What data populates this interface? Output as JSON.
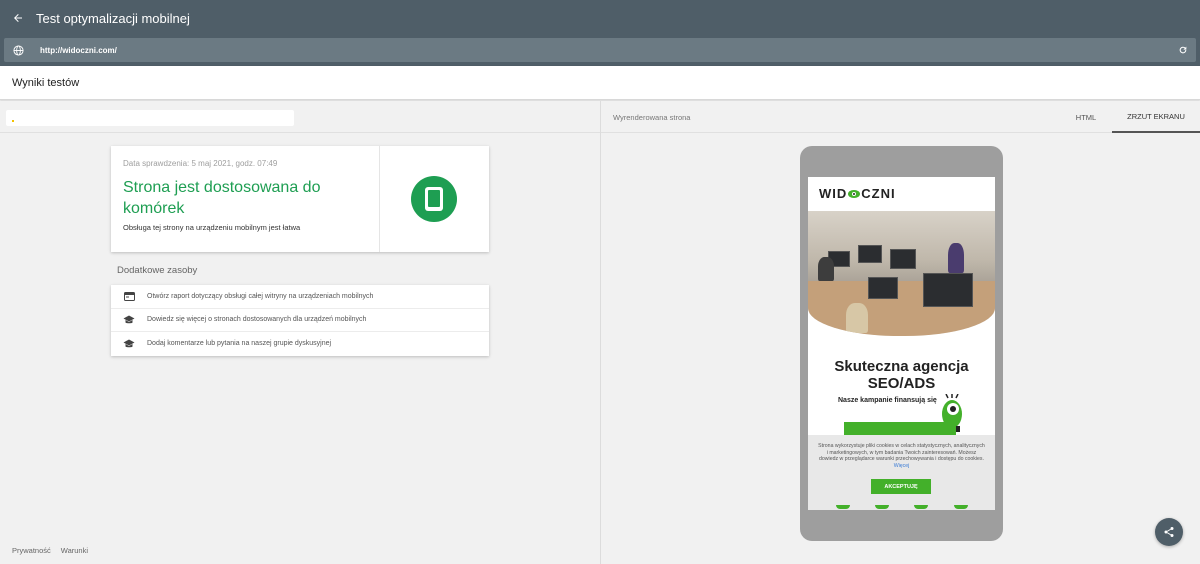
{
  "app": {
    "title": "Test optymalizacji mobilnej",
    "url": "http://widoczni.com/"
  },
  "results_header": "Wyniki testów",
  "result_card": {
    "date": "Data sprawdzenia: 5 maj 2021, godz. 07:49",
    "headline": "Strona jest dostosowana do komórek",
    "description": "Obsługa tej strony na urządzeniu mobilnym jest łatwa",
    "accent_color": "#1e9e52"
  },
  "additional": {
    "title": "Dodatkowe zasoby",
    "items": [
      {
        "icon": "web-report-icon",
        "label": "Otwórz raport dotyczący obsługi całej witryny na urządzeniach mobilnych"
      },
      {
        "icon": "school-icon",
        "label": "Dowiedz się więcej o stronach dostosowanych dla urządzeń mobilnych"
      },
      {
        "icon": "school-icon",
        "label": "Dodaj komentarze lub pytania na naszej grupie dyskusyjnej"
      }
    ]
  },
  "footer": {
    "privacy": "Prywatność",
    "terms": "Warunki"
  },
  "render_panel": {
    "label": "Wyrenderowana strona",
    "tab_html": "HTML",
    "tab_screenshot": "ZRZUT EKRANU",
    "active_tab": "ZRZUT EKRANU"
  },
  "preview": {
    "logo_left": "WID",
    "logo_right": "CZNI",
    "heading_line1": "Skuteczna agencja",
    "heading_line2": "SEO/ADS",
    "subheading": "Nasze kampanie finansują się",
    "cookie_text": "Strona wykorzystuje pliki cookies w celach statystycznych, analitycznych i marketingowych, w tym badania Twoich zainteresowań. Możesz dowiedz w przeglądarce warunki przechowywania i dostępu do cookies.",
    "cookie_more": "Więcej",
    "cookie_accept": "AKCEPTUJĘ",
    "brand_green": "#43b02a"
  }
}
